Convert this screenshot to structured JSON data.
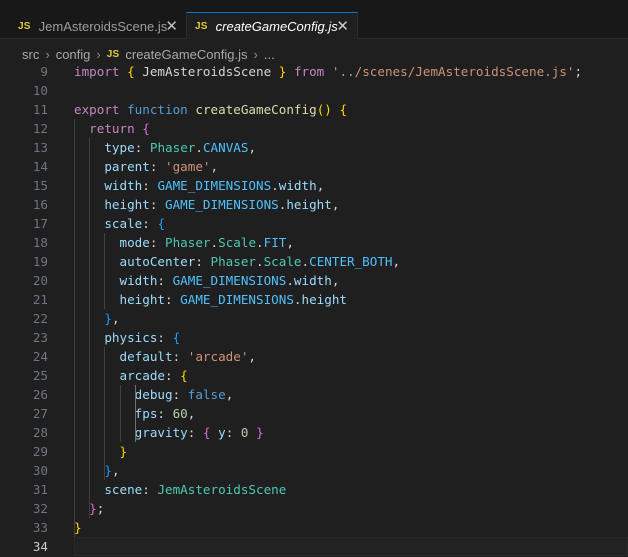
{
  "tabs": [
    {
      "icon": "JS",
      "label": "JemAsteroidsScene.js",
      "close": "✕",
      "active": false
    },
    {
      "icon": "JS",
      "label": "createGameConfig.js",
      "close": "✕",
      "active": true
    }
  ],
  "breadcrumb": {
    "segments": [
      "src",
      "config"
    ],
    "file_icon": "JS",
    "file": "createGameConfig.js",
    "ellipsis": "...",
    "separator": "›"
  },
  "editor": {
    "current_line": 34,
    "lines": [
      {
        "n": "9",
        "t": [
          [
            "kw",
            "import"
          ],
          [
            "txt",
            " "
          ],
          [
            "b1",
            "{"
          ],
          [
            "txt",
            " JemAsteroidsScene "
          ],
          [
            "b1",
            "}"
          ],
          [
            "txt",
            " "
          ],
          [
            "kw",
            "from"
          ],
          [
            "txt",
            " "
          ],
          [
            "str",
            "'../scenes/JemAsteroidsScene.js'"
          ],
          [
            "txt",
            ";"
          ]
        ]
      },
      {
        "n": "10",
        "t": []
      },
      {
        "n": "11",
        "t": [
          [
            "kw",
            "export"
          ],
          [
            "txt",
            " "
          ],
          [
            "kw2",
            "function"
          ],
          [
            "txt",
            " "
          ],
          [
            "fn",
            "createGameConfig"
          ],
          [
            "b1",
            "()"
          ],
          [
            "txt",
            " "
          ],
          [
            "b1",
            "{"
          ]
        ]
      },
      {
        "n": "12",
        "t": [
          [
            "txt",
            "  "
          ],
          [
            "kw",
            "return"
          ],
          [
            "txt",
            " "
          ],
          [
            "b2",
            "{"
          ]
        ]
      },
      {
        "n": "13",
        "t": [
          [
            "txt",
            "    "
          ],
          [
            "prop",
            "type"
          ],
          [
            "txt",
            ": "
          ],
          [
            "cls",
            "Phaser"
          ],
          [
            "txt",
            "."
          ],
          [
            "const",
            "CANVAS"
          ],
          [
            "txt",
            ","
          ]
        ]
      },
      {
        "n": "14",
        "t": [
          [
            "txt",
            "    "
          ],
          [
            "prop",
            "parent"
          ],
          [
            "txt",
            ": "
          ],
          [
            "str",
            "'game'"
          ],
          [
            "txt",
            ","
          ]
        ]
      },
      {
        "n": "15",
        "t": [
          [
            "txt",
            "    "
          ],
          [
            "prop",
            "width"
          ],
          [
            "txt",
            ": "
          ],
          [
            "const",
            "GAME_DIMENSIONS"
          ],
          [
            "txt",
            "."
          ],
          [
            "prop",
            "width"
          ],
          [
            "txt",
            ","
          ]
        ]
      },
      {
        "n": "16",
        "t": [
          [
            "txt",
            "    "
          ],
          [
            "prop",
            "height"
          ],
          [
            "txt",
            ": "
          ],
          [
            "const",
            "GAME_DIMENSIONS"
          ],
          [
            "txt",
            "."
          ],
          [
            "prop",
            "height"
          ],
          [
            "txt",
            ","
          ]
        ]
      },
      {
        "n": "17",
        "t": [
          [
            "txt",
            "    "
          ],
          [
            "prop",
            "scale"
          ],
          [
            "txt",
            ": "
          ],
          [
            "b3",
            "{"
          ]
        ]
      },
      {
        "n": "18",
        "t": [
          [
            "txt",
            "      "
          ],
          [
            "prop",
            "mode"
          ],
          [
            "txt",
            ": "
          ],
          [
            "cls",
            "Phaser"
          ],
          [
            "txt",
            "."
          ],
          [
            "cls",
            "Scale"
          ],
          [
            "txt",
            "."
          ],
          [
            "const",
            "FIT"
          ],
          [
            "txt",
            ","
          ]
        ]
      },
      {
        "n": "19",
        "t": [
          [
            "txt",
            "      "
          ],
          [
            "prop",
            "autoCenter"
          ],
          [
            "txt",
            ": "
          ],
          [
            "cls",
            "Phaser"
          ],
          [
            "txt",
            "."
          ],
          [
            "cls",
            "Scale"
          ],
          [
            "txt",
            "."
          ],
          [
            "const",
            "CENTER_BOTH"
          ],
          [
            "txt",
            ","
          ]
        ]
      },
      {
        "n": "20",
        "t": [
          [
            "txt",
            "      "
          ],
          [
            "prop",
            "width"
          ],
          [
            "txt",
            ": "
          ],
          [
            "const",
            "GAME_DIMENSIONS"
          ],
          [
            "txt",
            "."
          ],
          [
            "prop",
            "width"
          ],
          [
            "txt",
            ","
          ]
        ]
      },
      {
        "n": "21",
        "t": [
          [
            "txt",
            "      "
          ],
          [
            "prop",
            "height"
          ],
          [
            "txt",
            ": "
          ],
          [
            "const",
            "GAME_DIMENSIONS"
          ],
          [
            "txt",
            "."
          ],
          [
            "prop",
            "height"
          ]
        ]
      },
      {
        "n": "22",
        "t": [
          [
            "txt",
            "    "
          ],
          [
            "b3",
            "}"
          ],
          [
            "txt",
            ","
          ]
        ]
      },
      {
        "n": "23",
        "t": [
          [
            "txt",
            "    "
          ],
          [
            "prop",
            "physics"
          ],
          [
            "txt",
            ": "
          ],
          [
            "b3",
            "{"
          ]
        ]
      },
      {
        "n": "24",
        "t": [
          [
            "txt",
            "      "
          ],
          [
            "prop",
            "default"
          ],
          [
            "txt",
            ": "
          ],
          [
            "str",
            "'arcade'"
          ],
          [
            "txt",
            ","
          ]
        ]
      },
      {
        "n": "25",
        "t": [
          [
            "txt",
            "      "
          ],
          [
            "prop",
            "arcade"
          ],
          [
            "txt",
            ": "
          ],
          [
            "b1",
            "{"
          ]
        ]
      },
      {
        "n": "26",
        "t": [
          [
            "txt",
            "        "
          ],
          [
            "prop",
            "debug"
          ],
          [
            "txt",
            ": "
          ],
          [
            "kw2",
            "false"
          ],
          [
            "txt",
            ","
          ]
        ]
      },
      {
        "n": "27",
        "t": [
          [
            "txt",
            "        "
          ],
          [
            "prop",
            "fps"
          ],
          [
            "txt",
            ": "
          ],
          [
            "num",
            "60"
          ],
          [
            "txt",
            ","
          ]
        ]
      },
      {
        "n": "28",
        "t": [
          [
            "txt",
            "        "
          ],
          [
            "prop",
            "gravity"
          ],
          [
            "txt",
            ": "
          ],
          [
            "b2",
            "{"
          ],
          [
            "txt",
            " "
          ],
          [
            "prop",
            "y"
          ],
          [
            "txt",
            ": "
          ],
          [
            "num",
            "0"
          ],
          [
            "txt",
            " "
          ],
          [
            "b2",
            "}"
          ]
        ]
      },
      {
        "n": "29",
        "t": [
          [
            "txt",
            "      "
          ],
          [
            "b1",
            "}"
          ]
        ]
      },
      {
        "n": "30",
        "t": [
          [
            "txt",
            "    "
          ],
          [
            "b3",
            "}"
          ],
          [
            "txt",
            ","
          ]
        ]
      },
      {
        "n": "31",
        "t": [
          [
            "txt",
            "    "
          ],
          [
            "prop",
            "scene"
          ],
          [
            "txt",
            ": "
          ],
          [
            "cls",
            "JemAsteroidsScene"
          ]
        ]
      },
      {
        "n": "32",
        "t": [
          [
            "txt",
            "  "
          ],
          [
            "b2",
            "}"
          ],
          [
            "txt",
            ";"
          ]
        ]
      },
      {
        "n": "33",
        "t": [
          [
            "b1",
            "}"
          ]
        ]
      },
      {
        "n": "34",
        "t": []
      }
    ]
  }
}
